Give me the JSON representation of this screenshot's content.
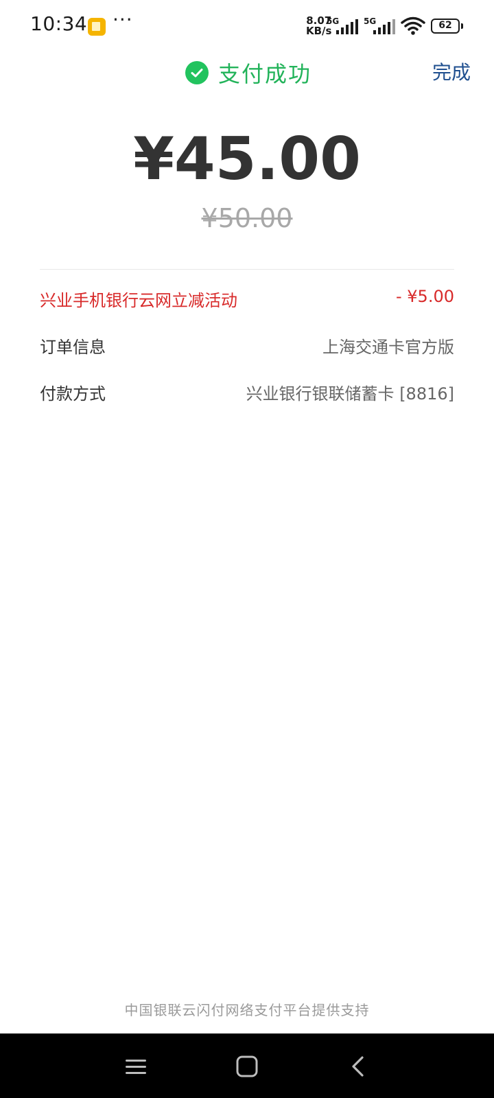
{
  "status_bar": {
    "time": "10:34",
    "app_icon": "notes-app-icon",
    "more": "···",
    "net_speed_value": "8.07",
    "net_speed_unit": "KB/s",
    "sim1_tag": "5G",
    "sim2_tag": "5G",
    "battery": "62"
  },
  "header": {
    "title": "支付成功",
    "done_label": "完成",
    "success_color": "#22c35e",
    "done_color": "#1f4f8f"
  },
  "payment": {
    "amount": "¥45.00",
    "original_amount": "¥50.00"
  },
  "details": {
    "discount": {
      "label": "兴业手机银行云网立减活动",
      "value": "- ¥5.00",
      "color": "#d82a2a"
    },
    "order": {
      "label": "订单信息",
      "value": "上海交通卡官方版"
    },
    "payment_method": {
      "label": "付款方式",
      "value": "兴业银行银联储蓄卡 [8816]"
    }
  },
  "footer": {
    "text": "中国银联云闪付网络支付平台提供支持"
  },
  "nav_bar": {
    "buttons": [
      "menu-icon",
      "home-icon",
      "back-icon"
    ]
  }
}
